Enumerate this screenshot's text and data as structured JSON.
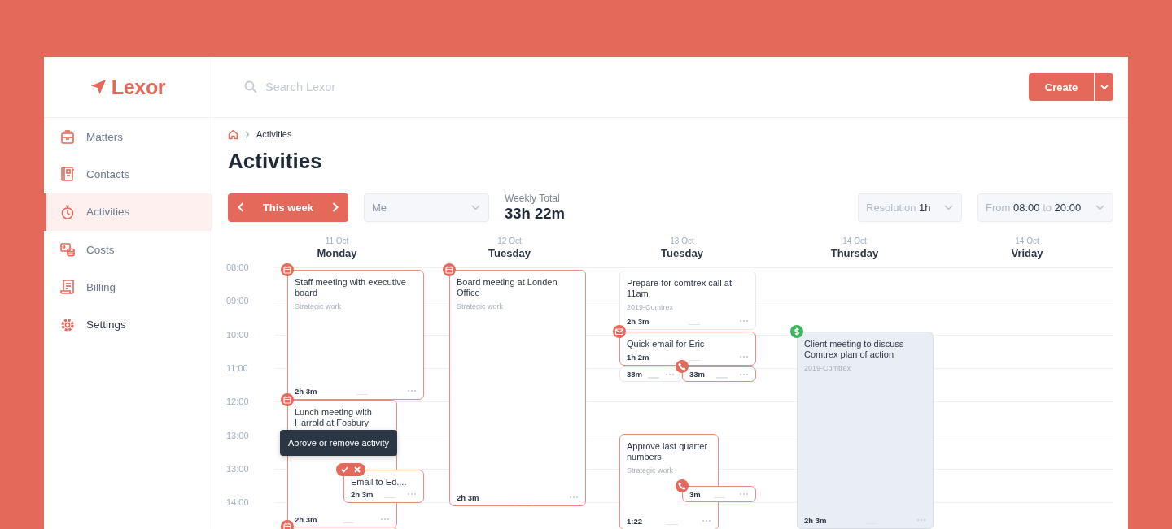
{
  "sidebar": {
    "logo": "Lexor",
    "items": [
      {
        "label": "Matters",
        "selected": false,
        "hovered": false
      },
      {
        "label": "Contacts",
        "selected": false,
        "hovered": false
      },
      {
        "label": "Activities",
        "selected": true,
        "hovered": false
      },
      {
        "label": "Costs",
        "selected": false,
        "hovered": false
      },
      {
        "label": "Billing",
        "selected": false,
        "hovered": false
      },
      {
        "label": "Settings",
        "selected": false,
        "hovered": true
      }
    ]
  },
  "header": {
    "search": {
      "placeholder": "Search Lexor"
    },
    "create_button": "Create"
  },
  "breadcrumb": [
    "Activities"
  ],
  "title": "Activities",
  "toolbar": {
    "week_button": "This week",
    "person_select": "Me",
    "weekly_total": {
      "label": "Weekly Total",
      "value": "33h 22m"
    },
    "resolution": {
      "label": "Resolution",
      "value": "1h"
    },
    "range": {
      "from_label": "From",
      "start": "08:00",
      "to_label": "to",
      "end": "20:00"
    }
  },
  "calendar": {
    "days": [
      {
        "date": "11 Oct",
        "name": "Monday"
      },
      {
        "date": "12 Oct",
        "name": "Tuesday"
      },
      {
        "date": "13 Oct",
        "name": "Tuesday"
      },
      {
        "date": "14 Oct",
        "name": "Thursday"
      },
      {
        "date": "14 Oct",
        "name": "Vriday"
      }
    ],
    "times": [
      "08:00",
      "09:00",
      "10:00",
      "11:00",
      "12:00",
      "13:00",
      "13:00",
      "14:00"
    ],
    "events": [
      {
        "title": "Staff meeting with executive board",
        "subtitle": "Strategic work",
        "duration": "2h 3m",
        "kind": "calendar",
        "approved": true,
        "billed": false
      },
      {
        "title": "Lunch meeting with Harrold at Fosbury",
        "duration": "2h 3m",
        "kind": "calendar",
        "approved": true,
        "billed": false
      },
      {
        "title": "Email to Ed....",
        "duration": "2h 3m",
        "kind": "plain",
        "approved": true,
        "billed": false,
        "tooltip": "Aprove or remove activity"
      },
      {
        "kind": "calendar"
      },
      {
        "title": "Board meeting at Londen Office",
        "subtitle": "Strategic work",
        "duration": "2h 3m",
        "kind": "calendar",
        "approved": true,
        "billed": false
      },
      {
        "title": "Prepare for comtrex call at 11am",
        "subtitle": "2019-Comtrex",
        "duration": "2h 3m",
        "kind": "plain",
        "approved": false,
        "billed": false
      },
      {
        "title": "Quick email for Eric",
        "duration": "1h 2m",
        "kind": "mail",
        "approved": true,
        "billed": false
      },
      {
        "duration": "33m",
        "kind": "plain",
        "approved": false,
        "billed": false
      },
      {
        "duration": "33m",
        "kind": "phone",
        "approved": true,
        "billed": false
      },
      {
        "title": "Approve last quarter numbers",
        "subtitle": "Strategic work",
        "duration": "1:22",
        "kind": "plain",
        "approved": true,
        "billed": false
      },
      {
        "duration": "3m",
        "kind": "phone",
        "approved": true,
        "billed": false
      },
      {
        "title": "Client meeting to discuss Comtrex plan of action",
        "subtitle": "2019-Comtrex",
        "duration": "2h 3m",
        "kind": "dollar",
        "billed": true
      }
    ]
  }
}
